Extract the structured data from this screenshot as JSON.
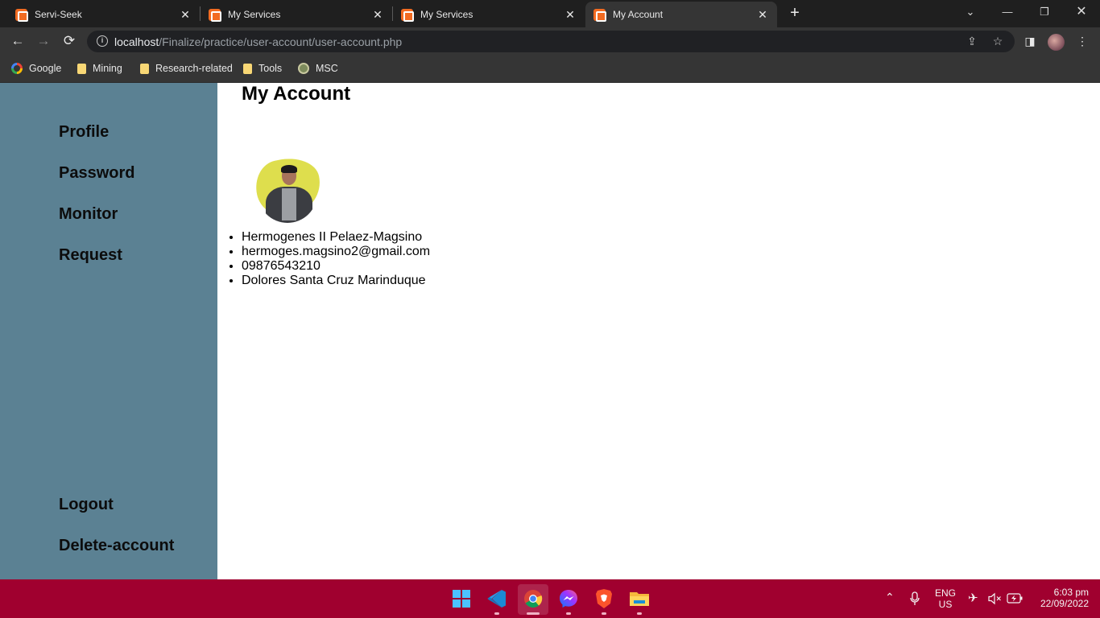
{
  "browser": {
    "tabs": [
      {
        "title": "Servi-Seek",
        "active": false
      },
      {
        "title": "My Services",
        "active": false
      },
      {
        "title": "My Services",
        "active": false
      },
      {
        "title": "My Account",
        "active": true
      }
    ],
    "tab_close_glyph": "✕",
    "new_tab_glyph": "+",
    "url_host": "localhost",
    "url_path": "/Finalize/practice/user-account/user-account.php",
    "bookmarks": [
      {
        "label": "Google",
        "icon": "google-icon"
      },
      {
        "label": "Mining",
        "icon": "folder-icon"
      },
      {
        "label": "Research-related",
        "icon": "folder-icon"
      },
      {
        "label": "Tools",
        "icon": "folder-icon"
      },
      {
        "label": "MSC",
        "icon": "msc-icon"
      }
    ]
  },
  "sidebar": {
    "top_links": [
      "Profile",
      "Password",
      "Monitor",
      "Request"
    ],
    "bottom_links": [
      "Logout",
      "Delete-account"
    ]
  },
  "main": {
    "title": "My Account",
    "user": {
      "name": "Hermogenes II Pelaez-Magsino",
      "email": "hermoges.magsino2@gmail.com",
      "phone": "09876543210",
      "address": "Dolores Santa Cruz Marinduque"
    }
  },
  "taskbar": {
    "apps": [
      "start-icon",
      "vscode-icon",
      "chrome-icon",
      "messenger-icon",
      "brave-icon",
      "file-explorer-icon"
    ],
    "language": "ENG",
    "region": "US",
    "time": "6:03 pm",
    "date": "22/09/2022"
  },
  "colors": {
    "sidebar": "#5b8193",
    "taskbar": "#a0002f",
    "avatar_blob": "#dede4d",
    "tab_favicon": "#f26b21"
  }
}
